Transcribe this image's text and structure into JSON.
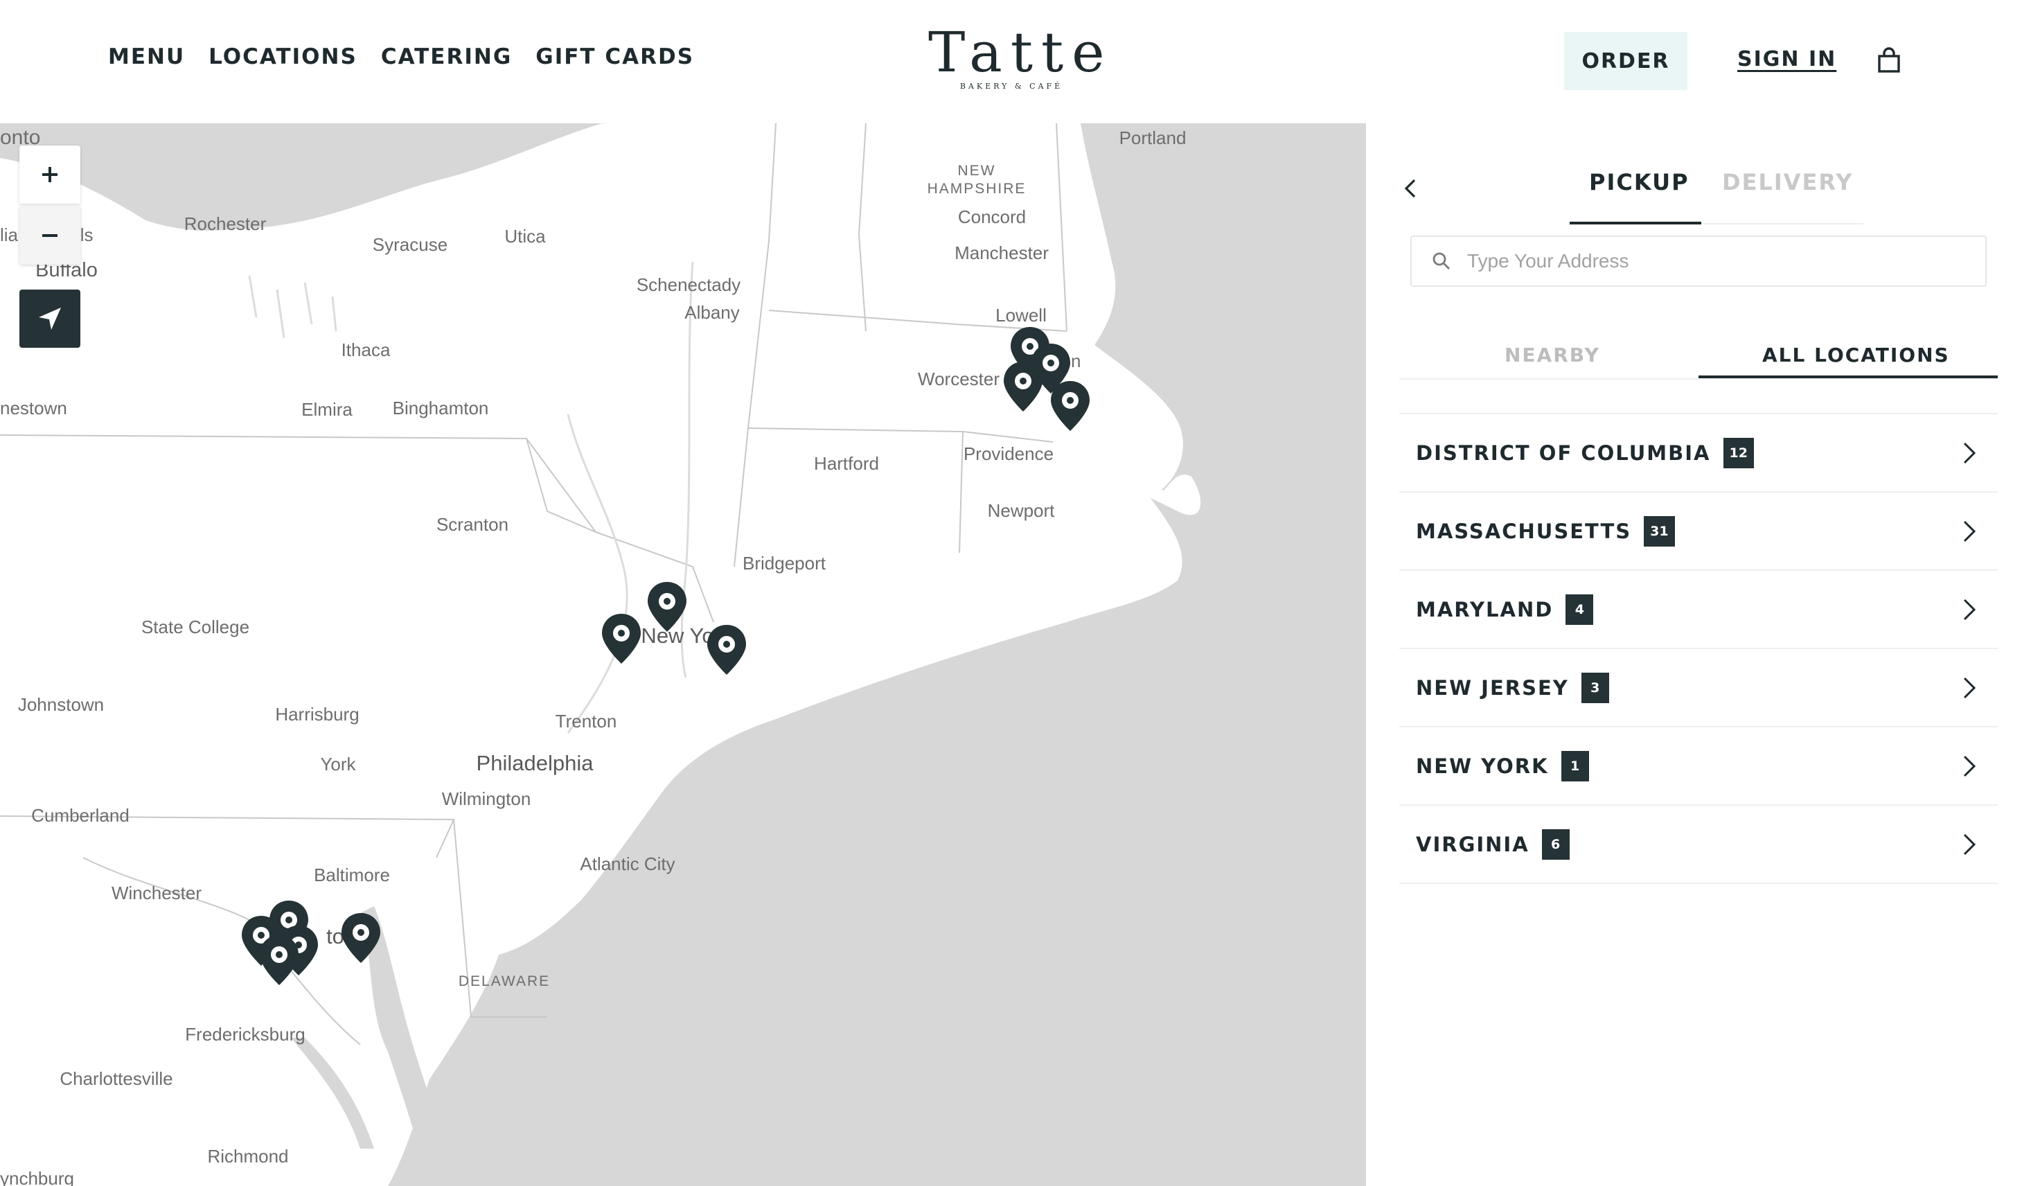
{
  "header": {
    "nav": [
      "MENU",
      "LOCATIONS",
      "CATERING",
      "GIFT CARDS"
    ],
    "logo_text": "Tatte",
    "logo_sub": "BAKERY & CAFÉ",
    "order_label": "ORDER",
    "signin_label": "SIGN IN",
    "bag_icon": "shopping-bag-icon"
  },
  "map": {
    "labels": {
      "toronto": "onto",
      "rochester": "Rochester",
      "syracuse": "Syracuse",
      "utica": "Utica",
      "niagara": "lia",
      "niagara2": "lls",
      "buffalo": "Buffalo",
      "schenectady": "Schenectady",
      "albany": "Albany",
      "ithaca": "Ithaca",
      "elmira": "Elmira",
      "binghamton": "Binghamton",
      "jamestown": "nestown",
      "portland": "Portland",
      "new_hampshire": "NEW\nHAMPSHIRE",
      "concord": "Concord",
      "manchester": "Manchester",
      "lowell": "Lowell",
      "boston": "n",
      "worcester": "Worcester",
      "hartford": "Hartford",
      "providence": "Providence",
      "newport": "Newport",
      "bridgeport": "Bridgeport",
      "scranton": "Scranton",
      "state_college": "State College",
      "new_york": "New Yo",
      "johnstown": "Johnstown",
      "harrisburg": "Harrisburg",
      "trenton": "Trenton",
      "york": "York",
      "philadelphia": "Philadelphia",
      "wilmington": "Wilmington",
      "cumberland": "Cumberland",
      "atlantic_city": "Atlantic City",
      "baltimore": "Baltimore",
      "winchester": "Winchester",
      "washington": "to",
      "delaware": "DELAWARE",
      "fredericksburg": "Fredericksburg",
      "charlottesville": "Charlottesville",
      "richmond": "Richmond",
      "lynchburg": "ynchburg"
    },
    "zoom_in_icon": "plus-icon",
    "zoom_out_icon": "minus-icon",
    "locate_icon": "navigation-arrow-icon",
    "marker_icon": "map-pin-icon"
  },
  "panel": {
    "back_icon": "chevron-left-icon",
    "tabs": {
      "pickup": "PICKUP",
      "delivery": "DELIVERY",
      "active": "pickup"
    },
    "search_placeholder": "Type Your Address",
    "search_icon": "search-icon",
    "subtabs": {
      "nearby": "NEARBY",
      "all": "ALL LOCATIONS",
      "active": "all"
    },
    "locations": [
      {
        "name": "DISTRICT OF COLUMBIA",
        "count": "12"
      },
      {
        "name": "MASSACHUSETTS",
        "count": "31"
      },
      {
        "name": "MARYLAND",
        "count": "4"
      },
      {
        "name": "NEW JERSEY",
        "count": "3"
      },
      {
        "name": "NEW YORK",
        "count": "1"
      },
      {
        "name": "VIRGINIA",
        "count": "6"
      }
    ],
    "row_icon": "chevron-right-icon"
  },
  "colors": {
    "brand_dark": "#253236",
    "order_bg": "#e9f6f5",
    "map_land": "#ffffff",
    "map_water": "#d7d7d7",
    "inactive_text": "#c9c9c9"
  }
}
